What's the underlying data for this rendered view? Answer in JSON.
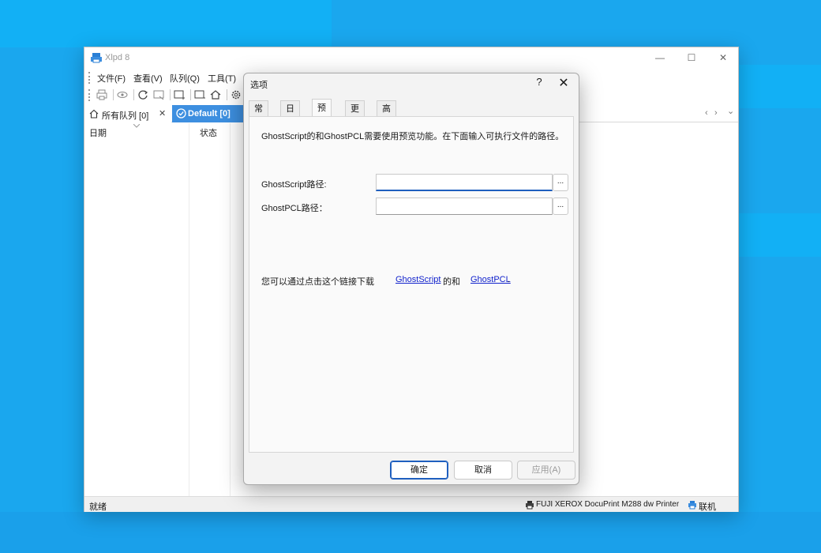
{
  "colors": {
    "desktop": "#1aa7ee",
    "accent": "#3d8fe0",
    "link": "#1122cc"
  },
  "app": {
    "title": "Xlpd 8"
  },
  "window_controls": {
    "minimize": "—",
    "maximize": "☐",
    "close": "✕"
  },
  "menu": [
    "文件(F)",
    "查看(V)",
    "队列(Q)",
    "工具(T)"
  ],
  "toolbar_icons": [
    "print-icon",
    "eye-icon",
    "refresh-icon",
    "window-icon",
    "add-queue-icon",
    "delete-queue-icon",
    "home-icon",
    "gear-icon"
  ],
  "tabs": {
    "all": {
      "label": "所有队列 [0]",
      "close": "✕"
    },
    "default": {
      "label": "Default [0]",
      "close": "✕"
    },
    "nav": {
      "prev": "‹",
      "next": "›",
      "menu": "⌄"
    }
  },
  "columns": [
    "日期",
    "状态"
  ],
  "status": {
    "left": "就绪",
    "printer": "FUJI XEROX DocuPrint M288 dw Printer",
    "online": "联机"
  },
  "dialog": {
    "title": "选项",
    "help": "?",
    "close": "✕",
    "tabs": [
      "常规",
      "日志",
      "预览",
      "更新",
      "高级"
    ],
    "active_tab": "预览",
    "description": "GhostScript的和GhostPCL需要使用预览功能。在下面输入可执行文件的路径。",
    "fields": [
      {
        "label": "GhostScript路径:",
        "value": "",
        "browse": "..."
      },
      {
        "label": "GhostPCL路径：",
        "value": "",
        "browse": "..."
      }
    ],
    "link_text_before": "您可以通过点击这个链接下载",
    "link_ghostscript": "GhostScript",
    "link_middle": "的和",
    "link_ghostpcl": "GhostPCL",
    "link_end": ".",
    "buttons": {
      "ok": "确定",
      "cancel": "取消",
      "apply": "应用(A)"
    }
  }
}
